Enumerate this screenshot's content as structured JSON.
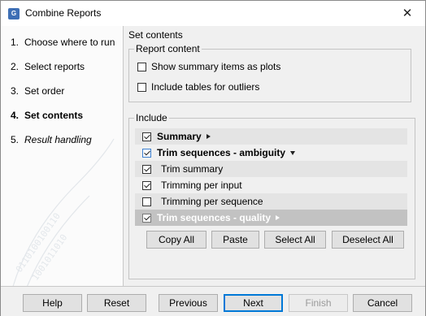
{
  "window": {
    "title": "Combine Reports",
    "app_icon_text": "G"
  },
  "steps": [
    {
      "num": "1.",
      "label": "Choose where to run"
    },
    {
      "num": "2.",
      "label": "Select reports"
    },
    {
      "num": "3.",
      "label": "Set order"
    },
    {
      "num": "4.",
      "label": "Set contents"
    },
    {
      "num": "5.",
      "label": "Result handling"
    }
  ],
  "main": {
    "section_title": "Set contents",
    "report_content": {
      "title": "Report content",
      "options": [
        {
          "label": "Show summary items as plots",
          "checked": false
        },
        {
          "label": "Include tables for outliers",
          "checked": false
        }
      ]
    },
    "include": {
      "title": "Include",
      "items": [
        {
          "label": "Summary",
          "checked": true
        },
        {
          "label": "Trim sequences - ambiguity",
          "checked": true
        },
        {
          "label": "Trim summary",
          "checked": true
        },
        {
          "label": "Trimming per input",
          "checked": true
        },
        {
          "label": "Trimming per sequence",
          "checked": false
        },
        {
          "label": "Trim sequences - quality",
          "checked": true
        }
      ],
      "buttons": {
        "copy_all": "Copy All",
        "paste": "Paste",
        "select_all": "Select All",
        "deselect_all": "Deselect All"
      }
    }
  },
  "footer": {
    "help": "Help",
    "reset": "Reset",
    "previous": "Previous",
    "next": "Next",
    "finish": "Finish",
    "cancel": "Cancel"
  }
}
